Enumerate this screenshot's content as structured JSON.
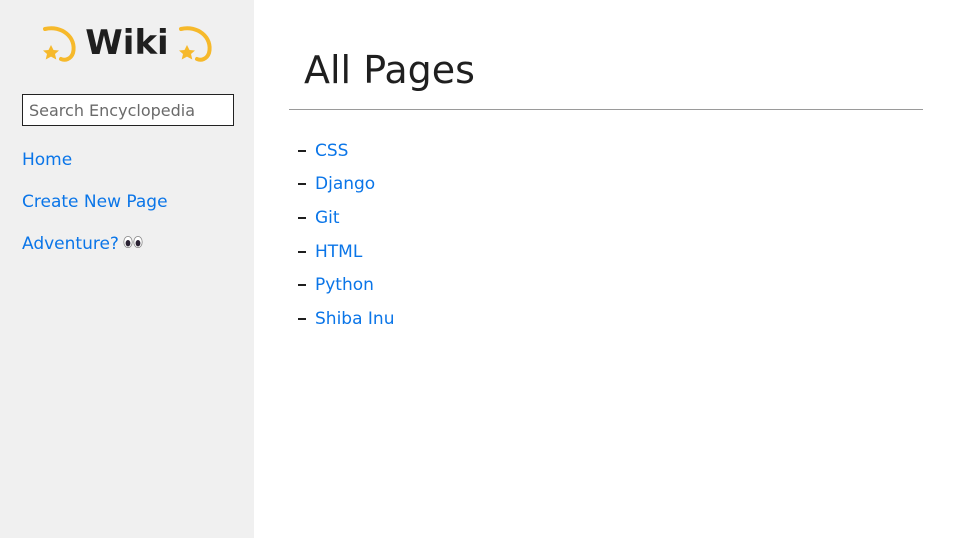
{
  "sidebar": {
    "brand": {
      "title": "Wiki",
      "left_icon": "dizzy-star-icon",
      "right_icon": "dizzy-star-icon",
      "icon_color": "#f6b92b"
    },
    "search": {
      "placeholder": "Search Encyclopedia",
      "value": ""
    },
    "nav": [
      {
        "label": "Home"
      },
      {
        "label": "Create New Page"
      },
      {
        "label": "Adventure?",
        "icon": "eyes-icon"
      }
    ]
  },
  "main": {
    "title": "All Pages",
    "pages": [
      {
        "label": "CSS"
      },
      {
        "label": "Django"
      },
      {
        "label": "Git"
      },
      {
        "label": "HTML"
      },
      {
        "label": "Python"
      },
      {
        "label": "Shiba Inu"
      }
    ]
  },
  "colors": {
    "link": "#0a75e8",
    "sidebar_bg": "#f0f0f0",
    "text": "#1f1f1f",
    "divider": "#9a9a9a"
  }
}
